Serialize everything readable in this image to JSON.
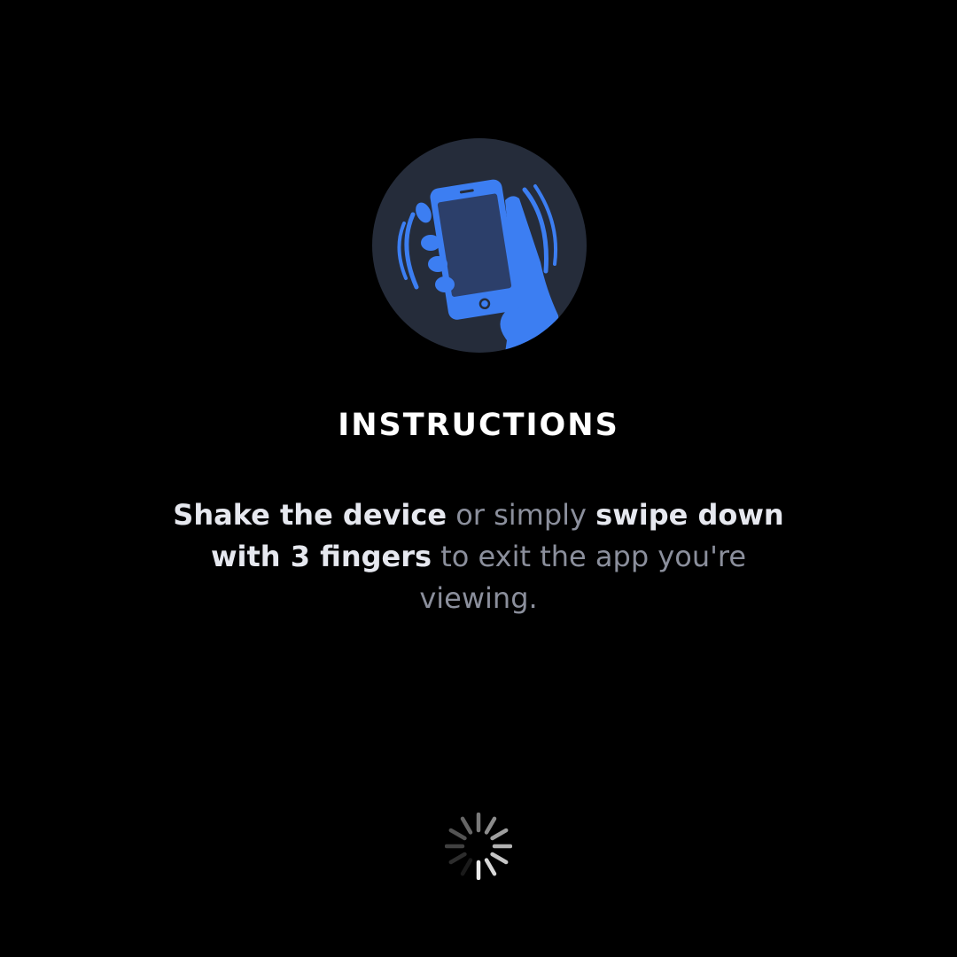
{
  "illustration": {
    "icon": "shake-phone-icon",
    "circle_color": "#252c3a",
    "accent_color": "#3c7ef2",
    "screen_color": "#2c3f6a"
  },
  "instructions": {
    "title": "INSTRUCTIONS",
    "segments": [
      {
        "text": "Shake the device",
        "emphasis": true
      },
      {
        "text": " or simply ",
        "emphasis": false
      },
      {
        "text": "swipe down with 3 fingers",
        "emphasis": true
      },
      {
        "text": " to exit the app you're viewing.",
        "emphasis": false
      }
    ]
  },
  "loading": {
    "icon": "loading-spinner-icon"
  }
}
